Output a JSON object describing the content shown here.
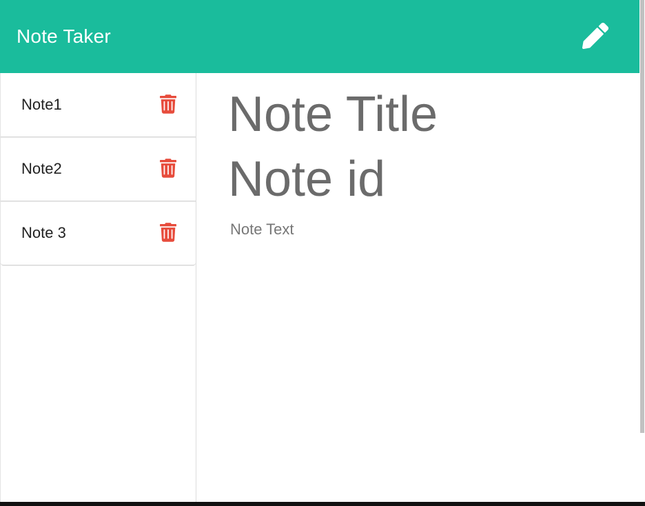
{
  "app": {
    "title": "Note Taker"
  },
  "header": {
    "new_note_icon": "pencil-icon"
  },
  "sidebar": {
    "items": [
      {
        "label": "Note1",
        "delete_icon": "trash-icon"
      },
      {
        "label": "Note2",
        "delete_icon": "trash-icon"
      },
      {
        "label": "Note 3",
        "delete_icon": "trash-icon"
      }
    ]
  },
  "editor": {
    "title": "Note Title",
    "id_label": "Note id",
    "text": "Note Text"
  },
  "colors": {
    "accent": "#1abc9c",
    "delete": "#e74c3c",
    "editor_text": "#6b6b6b"
  }
}
